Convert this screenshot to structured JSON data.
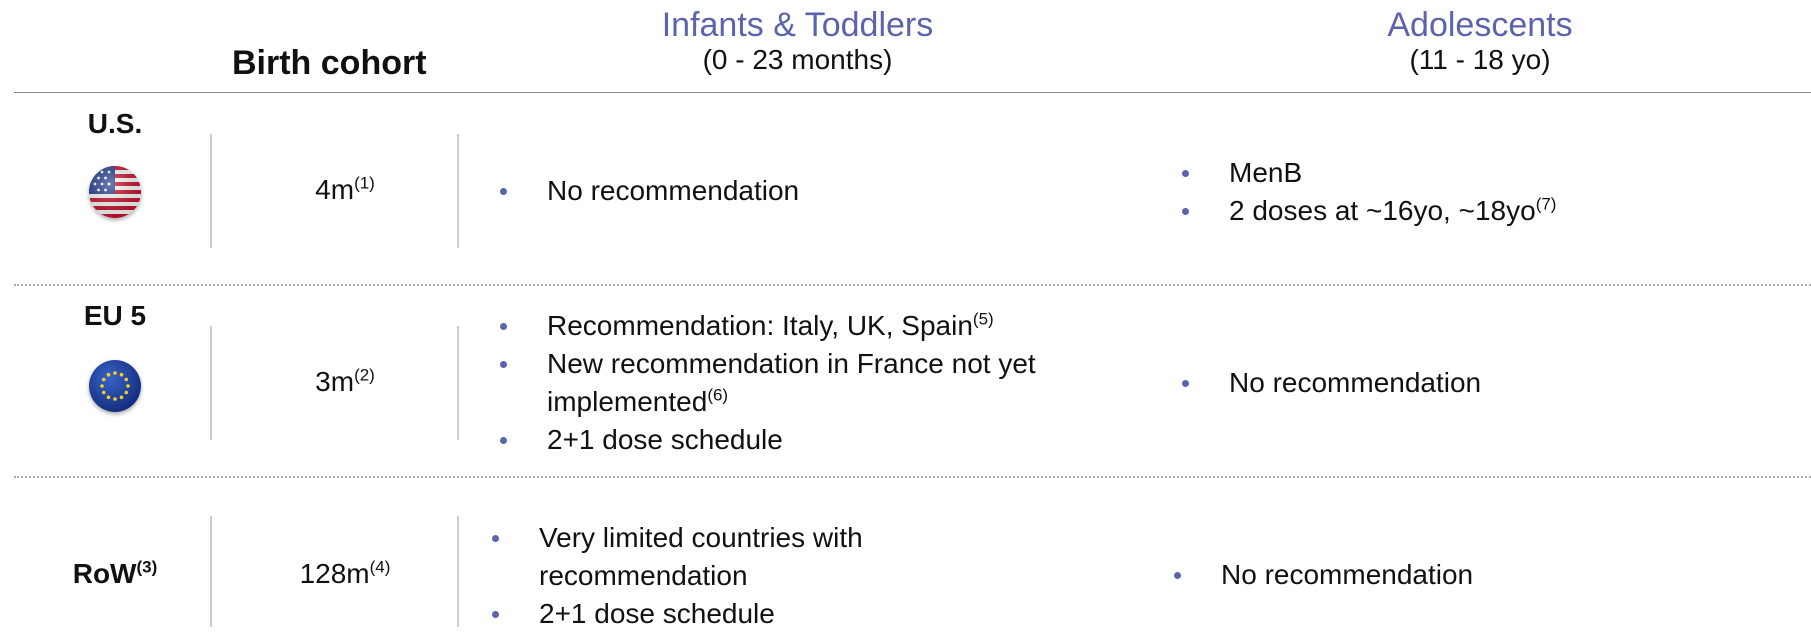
{
  "header": {
    "birth_cohort": "Birth cohort",
    "infants_title": "Infants & Toddlers",
    "infants_sub": "(0 - 23 months)",
    "adolescents_title": "Adolescents",
    "adolescents_sub": "(11 - 18 yo)"
  },
  "rows": [
    {
      "region": "U.S.",
      "flag_icon": "us-flag-icon",
      "cohort": "4m",
      "cohort_note": "(1)",
      "infants": [
        {
          "text": "No recommendation",
          "note": ""
        }
      ],
      "adolescents": [
        {
          "text": "MenB",
          "note": ""
        },
        {
          "text": "2 doses at ~16yo, ~18yo",
          "note": "(7)"
        }
      ]
    },
    {
      "region": "EU 5",
      "flag_icon": "eu-flag-icon",
      "cohort": "3m",
      "cohort_note": "(2)",
      "infants": [
        {
          "text": "Recommendation: Italy, UK, Spain",
          "note": "(5)"
        },
        {
          "text": "New recommendation in France not yet implemented",
          "note": "(6)"
        },
        {
          "text": "2+1 dose schedule",
          "note": ""
        }
      ],
      "adolescents": [
        {
          "text": "No recommendation",
          "note": ""
        }
      ]
    },
    {
      "region": "RoW",
      "region_note": "(3)",
      "cohort": "128m",
      "cohort_note": "(4)",
      "infants": [
        {
          "text": "Very limited countries with recommendation",
          "note": ""
        },
        {
          "text": "2+1 dose schedule",
          "note": ""
        }
      ],
      "adolescents": [
        {
          "text": "No recommendation",
          "note": ""
        }
      ]
    }
  ],
  "colors": {
    "accent": "#5c63ad",
    "divider": "#c9c9e2"
  }
}
